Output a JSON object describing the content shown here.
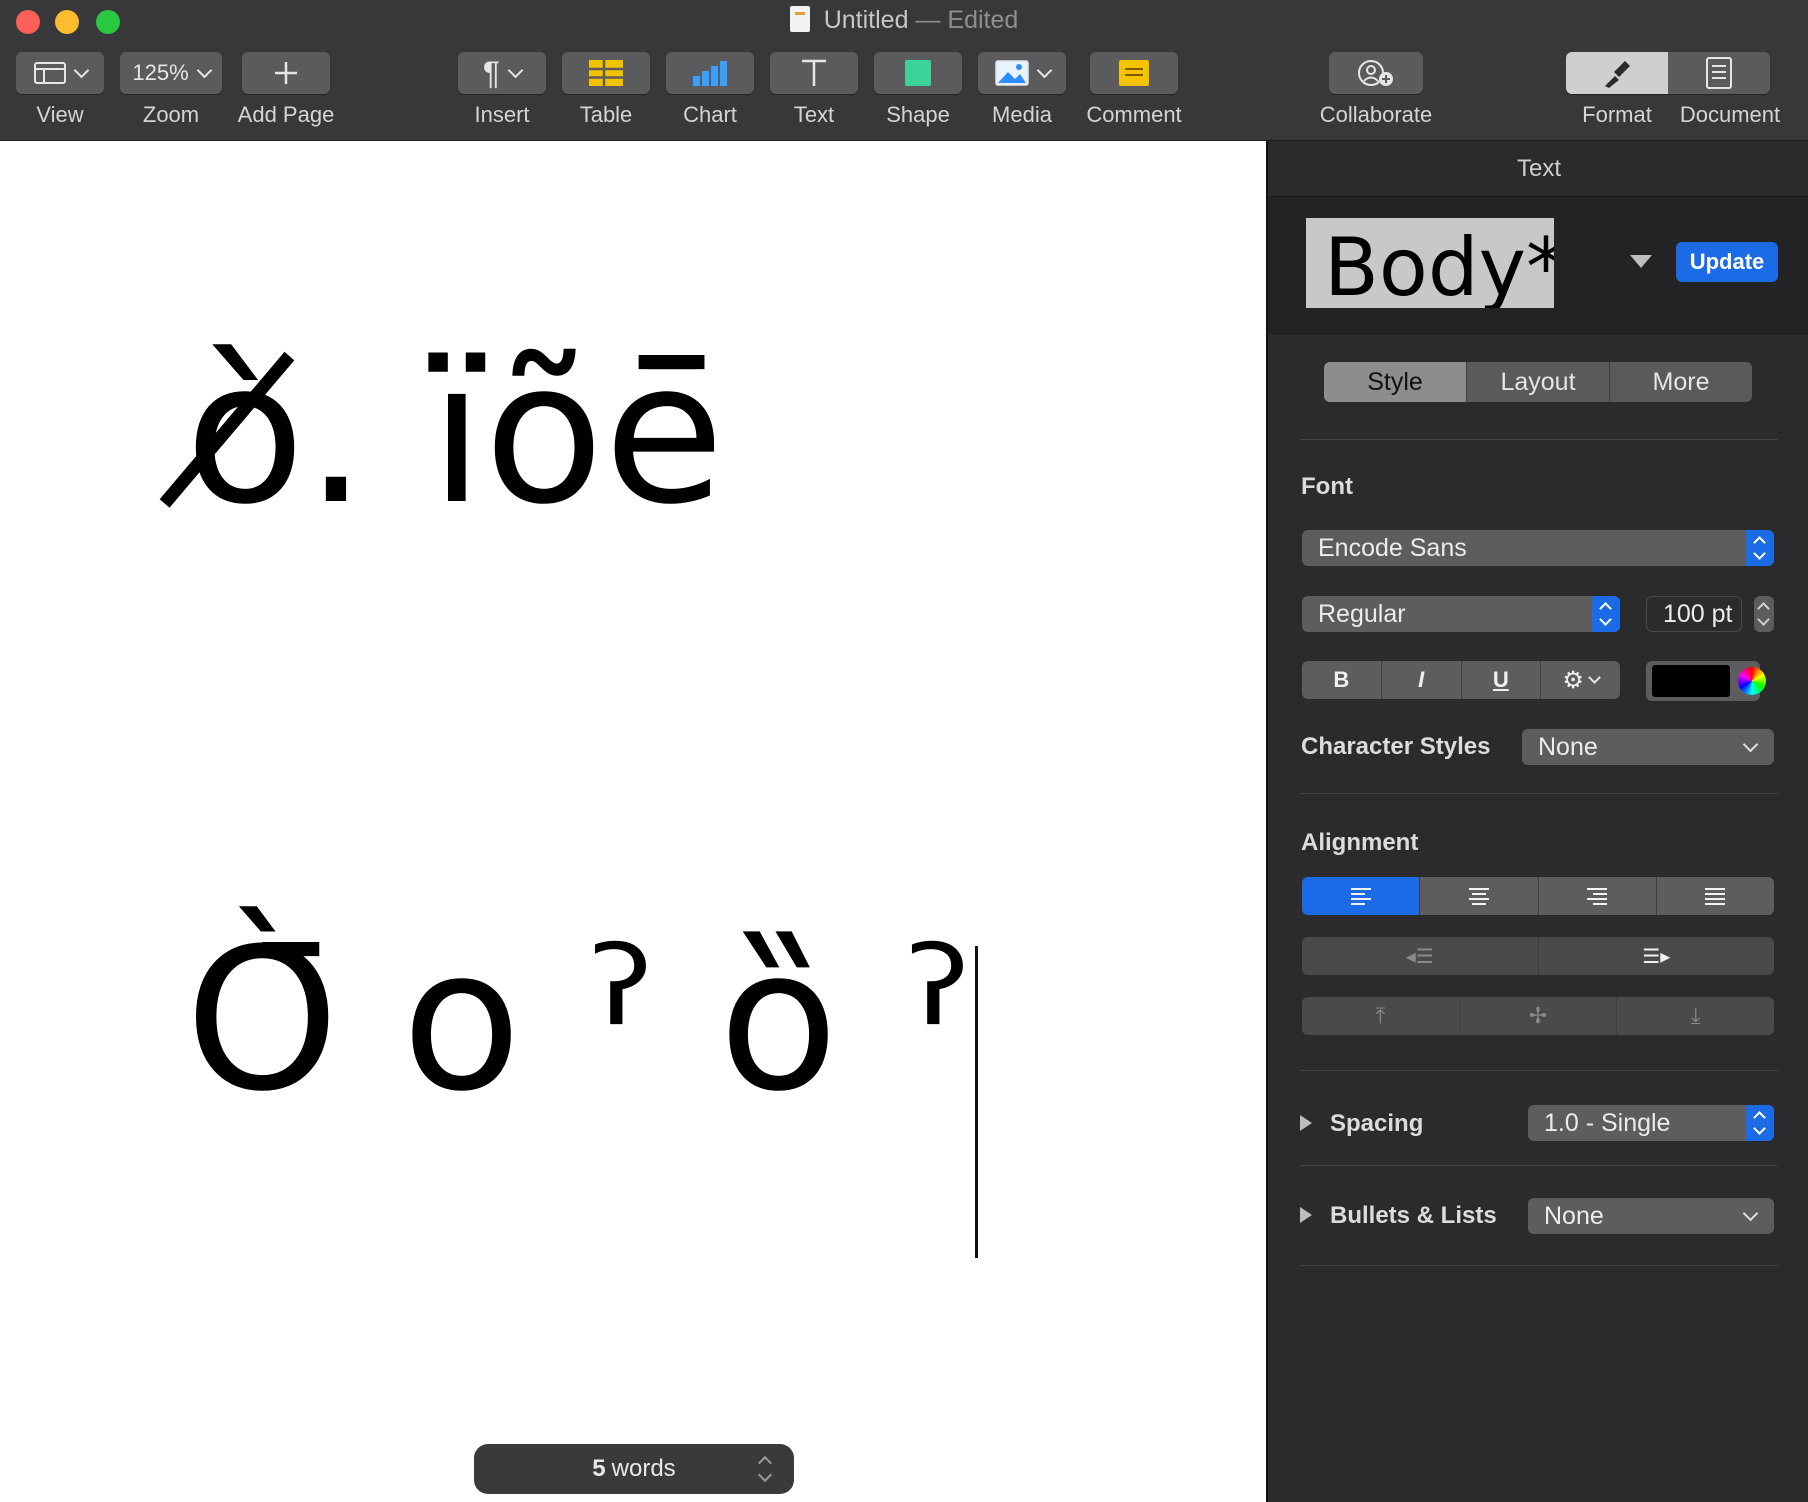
{
  "window": {
    "title": "Untitled",
    "title_sep": "—",
    "title_status": "Edited"
  },
  "toolbar": {
    "view": "View",
    "zoom_value": "125%",
    "zoom": "Zoom",
    "add_page": "Add Page",
    "insert": "Insert",
    "table": "Table",
    "chart": "Chart",
    "text": "Text",
    "shape": "Shape",
    "media": "Media",
    "comment": "Comment",
    "collaborate": "Collaborate",
    "format": "Format",
    "document": "Document"
  },
  "document": {
    "line1": "ò̸. ïõē̄",
    "line2": "Ò̄ o ˀ ȍ ˀ",
    "word_count_number": "5",
    "word_count_unit": "words"
  },
  "inspector": {
    "title": "Text",
    "paragraph_style": "Body*",
    "update_label": "Update",
    "tabs": [
      "Style",
      "Layout",
      "More"
    ],
    "font_label": "Font",
    "font_family": "Encode Sans",
    "font_typeface": "Regular",
    "font_size": "100 pt",
    "bold": "B",
    "italic": "I",
    "underline": "U",
    "text_color": "#000000",
    "character_styles_label": "Character Styles",
    "character_styles_value": "None",
    "alignment_label": "Alignment",
    "spacing_label": "Spacing",
    "spacing_value": "1.0 - Single",
    "bullets_label": "Bullets & Lists",
    "bullets_value": "None"
  },
  "colors": {
    "accent": "#1c6be6",
    "toolbar_bg": "#38383a",
    "inspector_bg": "#2b2b2d",
    "close": "#fe5f57",
    "minimize": "#febc2e",
    "maximize": "#28c840"
  }
}
